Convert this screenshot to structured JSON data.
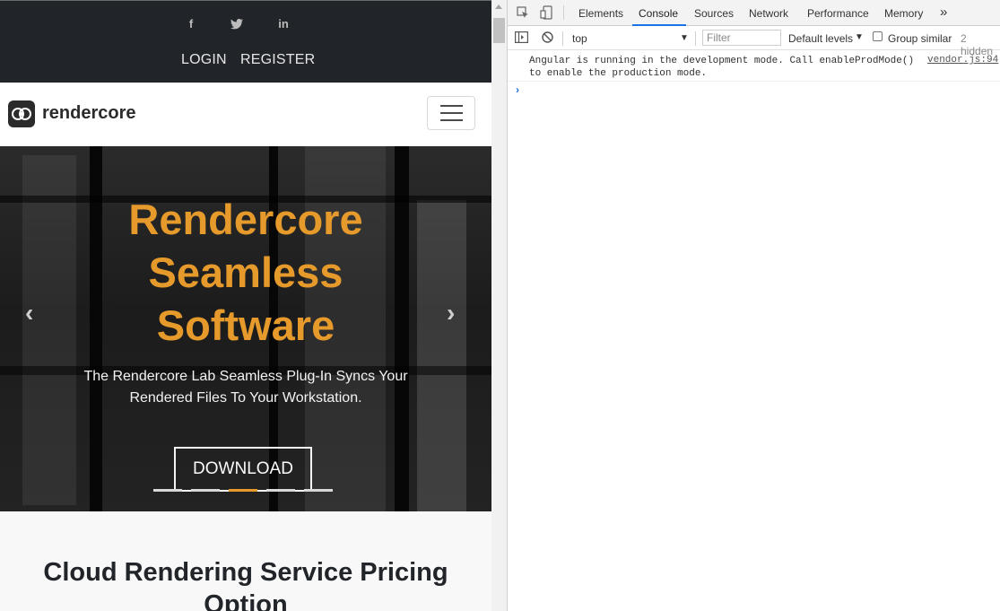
{
  "site": {
    "social": [
      "f",
      "t",
      "in"
    ],
    "auth": {
      "login": "LOGIN",
      "register": "REGISTER"
    },
    "brand": "rendercore",
    "hero": {
      "title_lines": [
        "Rendercore",
        "Seamless",
        "Software"
      ],
      "subtitle_lines": [
        "The Rendercore Lab Seamless Plug-In Syncs Your",
        "Rendered Files To Your Workstation."
      ],
      "button": "DOWNLOAD",
      "indicators": 5,
      "active_indicator": 3,
      "accent": "#e59a2b"
    },
    "pricing_title": "Cloud Rendering Service Pricing Option"
  },
  "devtools": {
    "tabs": [
      "Elements",
      "Console",
      "Sources",
      "Network",
      "Performance",
      "Memory"
    ],
    "active_tab": "Console",
    "more_tabs": "»",
    "toolbar": {
      "context": "top",
      "filter_placeholder": "Filter",
      "levels": "Default levels",
      "group_similar": "Group similar",
      "hidden_count": "2 hidden"
    },
    "console": {
      "message": "Angular is running in the development mode. Call enableProdMode()\nto enable the production mode.",
      "source": "vendor.js:94",
      "prompt": "›"
    }
  }
}
